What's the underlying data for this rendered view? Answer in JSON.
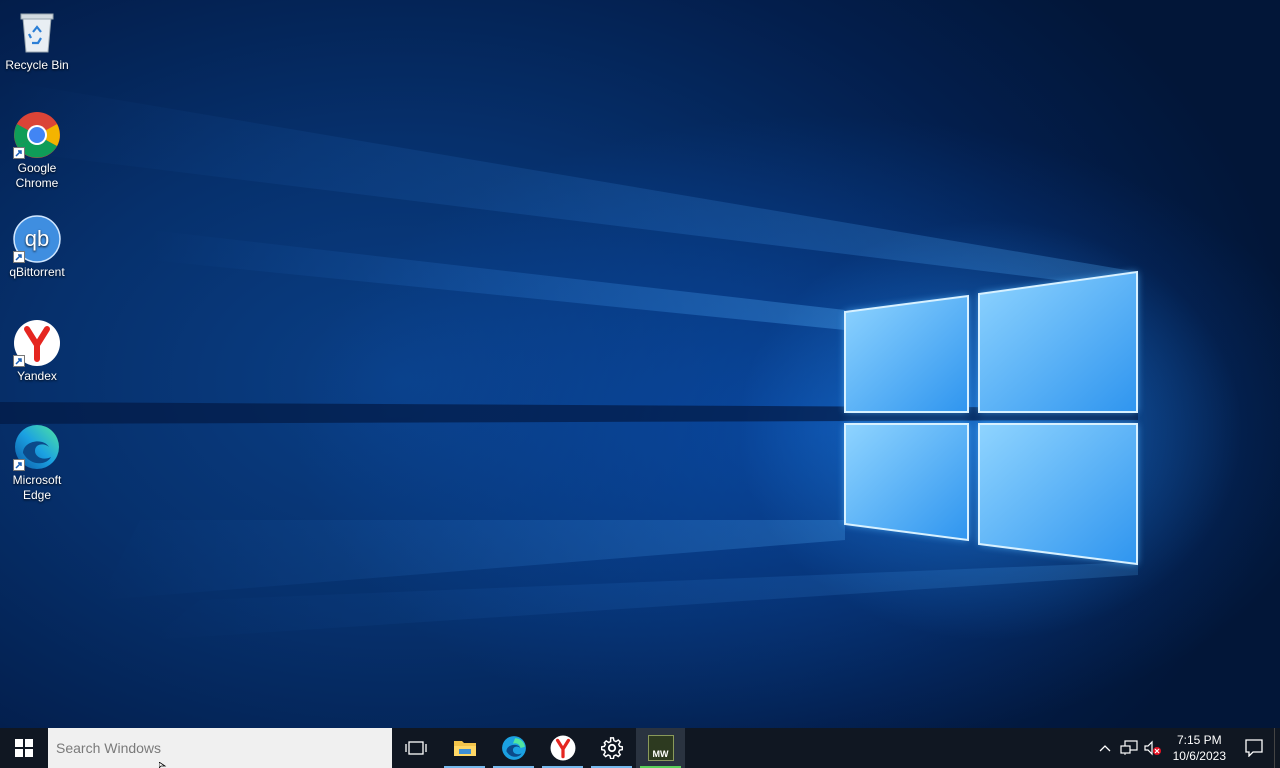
{
  "desktop": {
    "icons": [
      {
        "label": "Recycle Bin",
        "icon": "recycle-bin-icon"
      },
      {
        "label": "Google Chrome",
        "icon": "chrome-icon"
      },
      {
        "label": "qBittorrent",
        "icon": "qbittorrent-icon"
      },
      {
        "label": "Yandex",
        "icon": "yandex-icon"
      },
      {
        "label": "Microsoft Edge",
        "icon": "edge-icon"
      }
    ]
  },
  "taskbar": {
    "start_icon": "windows-logo-icon",
    "search_placeholder": "Search Windows",
    "pinned": [
      {
        "name": "task-view",
        "icon": "task-view-icon"
      },
      {
        "name": "file-explorer",
        "icon": "folder-icon"
      },
      {
        "name": "microsoft-edge",
        "icon": "edge-icon"
      },
      {
        "name": "yandex",
        "icon": "yandex-icon"
      },
      {
        "name": "settings",
        "icon": "gear-icon"
      },
      {
        "name": "mw-app",
        "icon": "mw-app-icon",
        "badge": "MW"
      }
    ],
    "tray": {
      "time": "7:15 PM",
      "date": "10/6/2023",
      "icons": [
        "chevron-up-icon",
        "network-icon",
        "volume-muted-icon",
        "notification-icon"
      ]
    }
  },
  "colors": {
    "taskbar_bg": "#101722",
    "accent": "#76b9ed",
    "wallpaper": "#0a3f86"
  }
}
